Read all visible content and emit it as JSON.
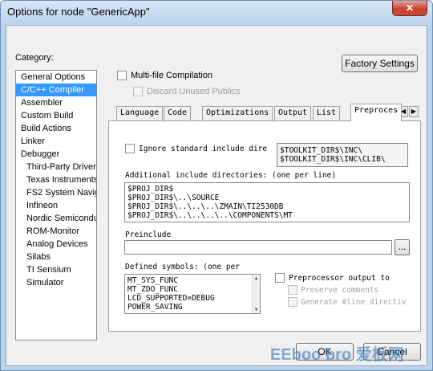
{
  "window": {
    "title": "Options for node \"GenericApp\"",
    "close_glyph": "✕"
  },
  "category": {
    "label": "Category:",
    "items": [
      {
        "label": "General Options",
        "sub": false
      },
      {
        "label": "C/C++ Compiler",
        "sub": false,
        "selected": true
      },
      {
        "label": "Assembler",
        "sub": false
      },
      {
        "label": "Custom Build",
        "sub": false
      },
      {
        "label": "Build Actions",
        "sub": false
      },
      {
        "label": "Linker",
        "sub": false
      },
      {
        "label": "Debugger",
        "sub": false
      },
      {
        "label": "Third-Party Driver",
        "sub": true
      },
      {
        "label": "Texas Instruments",
        "sub": true
      },
      {
        "label": "FS2 System Navig",
        "sub": true
      },
      {
        "label": "Infineon",
        "sub": true
      },
      {
        "label": "Nordic Semiconduc",
        "sub": true
      },
      {
        "label": "ROM-Monitor",
        "sub": true
      },
      {
        "label": "Analog Devices",
        "sub": true
      },
      {
        "label": "Silabs",
        "sub": true
      },
      {
        "label": "TI Sensium",
        "sub": true
      },
      {
        "label": "Simulator",
        "sub": true
      }
    ]
  },
  "options": {
    "factory_settings": "Factory Settings",
    "multi_file": "Multi-file Compilation",
    "discard_unused": "Discard Unused Publics"
  },
  "tabs": [
    "Language",
    "Code",
    "Optimizations",
    "Output",
    "List",
    "Preproces"
  ],
  "preprocessor": {
    "ignore_std": "Ignore standard include dire",
    "std_dirs": [
      "$TOOLKIT_DIR$\\INC\\",
      "$TOOLKIT_DIR$\\INC\\CLIB\\"
    ],
    "additional_label": "Additional include directories: (one per line)",
    "additional_dirs": [
      "$PROJ_DIR$",
      "$PROJ_DIR$\\..\\SOURCE",
      "$PROJ_DIR$\\..\\..\\..\\ZMAIN\\TI2530DB",
      "$PROJ_DIR$\\..\\..\\..\\..\\COMPONENTS\\MT"
    ],
    "preinclude_label": "Preinclude",
    "preinclude_browse": "...",
    "defined_label": "Defined symbols: (one per",
    "defined_symbols": [
      "MT_SYS_FUNC",
      "MT_ZDO_FUNC",
      "LCD_SUPPORTED=DEBUG",
      "POWER_SAVING"
    ],
    "pp_output": "Preprocessor output to",
    "preserve_comments": "Preserve comments",
    "generate_line": "Generate #line directiv"
  },
  "buttons": {
    "ok": "OK",
    "cancel": "Cancel"
  },
  "watermark": "EEboo bro 爱板网"
}
